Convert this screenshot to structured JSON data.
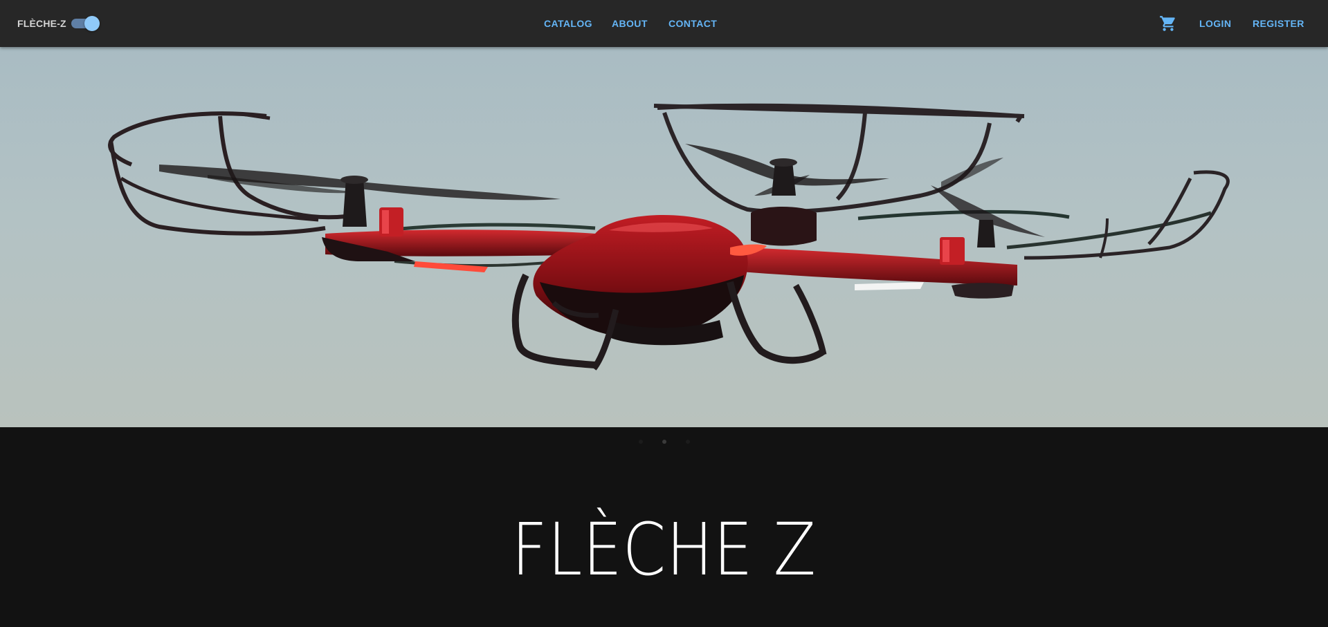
{
  "header": {
    "brand": "FLÈCHE-Z",
    "theme_toggle_on": true,
    "nav": [
      {
        "label": "CATALOG"
      },
      {
        "label": "ABOUT"
      },
      {
        "label": "CONTACT"
      }
    ],
    "cart_icon": "cart-icon",
    "login_label": "LOGIN",
    "register_label": "REGISTER"
  },
  "hero": {
    "image_subject": "red quadcopter drone with propeller guards in flight",
    "carousel": {
      "slide_count": 3,
      "active_index": 1
    }
  },
  "headline": "FLÈCHE Z",
  "colors": {
    "topbar_bg": "#272727",
    "page_bg": "#121212",
    "link_blue": "#64b5f6",
    "toggle_thumb": "#90caf9",
    "drone_red": "#b3131b"
  }
}
